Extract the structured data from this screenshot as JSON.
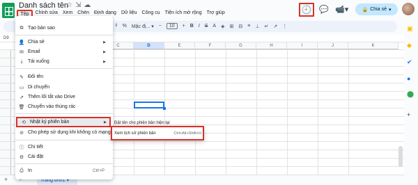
{
  "app": {
    "doc_title": "Danh sách tên"
  },
  "menubar": [
    "Tệp",
    "Chỉnh sửa",
    "Xem",
    "Chèn",
    "Định dạng",
    "Dữ liệu",
    "Công cụ",
    "Tiện ích mở rộng",
    "Trợ giúp"
  ],
  "header": {
    "share_label": "Chia sẻ"
  },
  "toolbar": {
    "font_label": "Mặc đị...",
    "font_size": "10",
    "currency": "₫",
    "percent": "%"
  },
  "formula_bar": {
    "cell_ref": "D9"
  },
  "grid": {
    "columns": [
      "C",
      "D",
      "E",
      "F",
      "G",
      "H",
      "I",
      "J",
      "K"
    ],
    "selected_column": "D"
  },
  "file_menu": {
    "items": [
      {
        "label": "Tạo bản sao",
        "icon": "copy-icon"
      },
      {
        "label": "Chia sẻ",
        "icon": "person-add-icon",
        "submenu": true
      },
      {
        "label": "Email",
        "icon": "email-icon",
        "submenu": true
      },
      {
        "label": "Tải xuống",
        "icon": "download-icon",
        "submenu": true
      },
      {
        "label": "Đổi tên",
        "icon": "rename-icon"
      },
      {
        "label": "Di chuyển",
        "icon": "move-icon"
      },
      {
        "label": "Thêm lối tắt vào Drive",
        "icon": "shortcut-icon"
      },
      {
        "label": "Chuyển vào thùng rác",
        "icon": "trash-icon"
      },
      {
        "label": "Nhật ký phiên bản",
        "icon": "history-icon",
        "submenu": true
      },
      {
        "label": "Cho phép sử dụng khi không có mạng",
        "icon": "offline-icon"
      },
      {
        "label": "Chi tiết",
        "icon": "info-icon"
      },
      {
        "label": "Cài đặt",
        "icon": "settings-icon"
      },
      {
        "label": "In",
        "icon": "print-icon",
        "shortcut": "Ctrl+P"
      }
    ]
  },
  "version_submenu": {
    "items": [
      {
        "label": "Đặt tên cho phiên bản hiện tại",
        "shortcut": ""
      },
      {
        "label": "Xem lịch sử phiên bản",
        "shortcut": "Ctrl+Alt+Shift+H"
      }
    ]
  },
  "sheets": {
    "active_tab": "Trang tính1"
  },
  "colors": {
    "accent": "#1a73e8",
    "highlight_box": "#d93025",
    "share_bg": "#c2e7ff"
  }
}
